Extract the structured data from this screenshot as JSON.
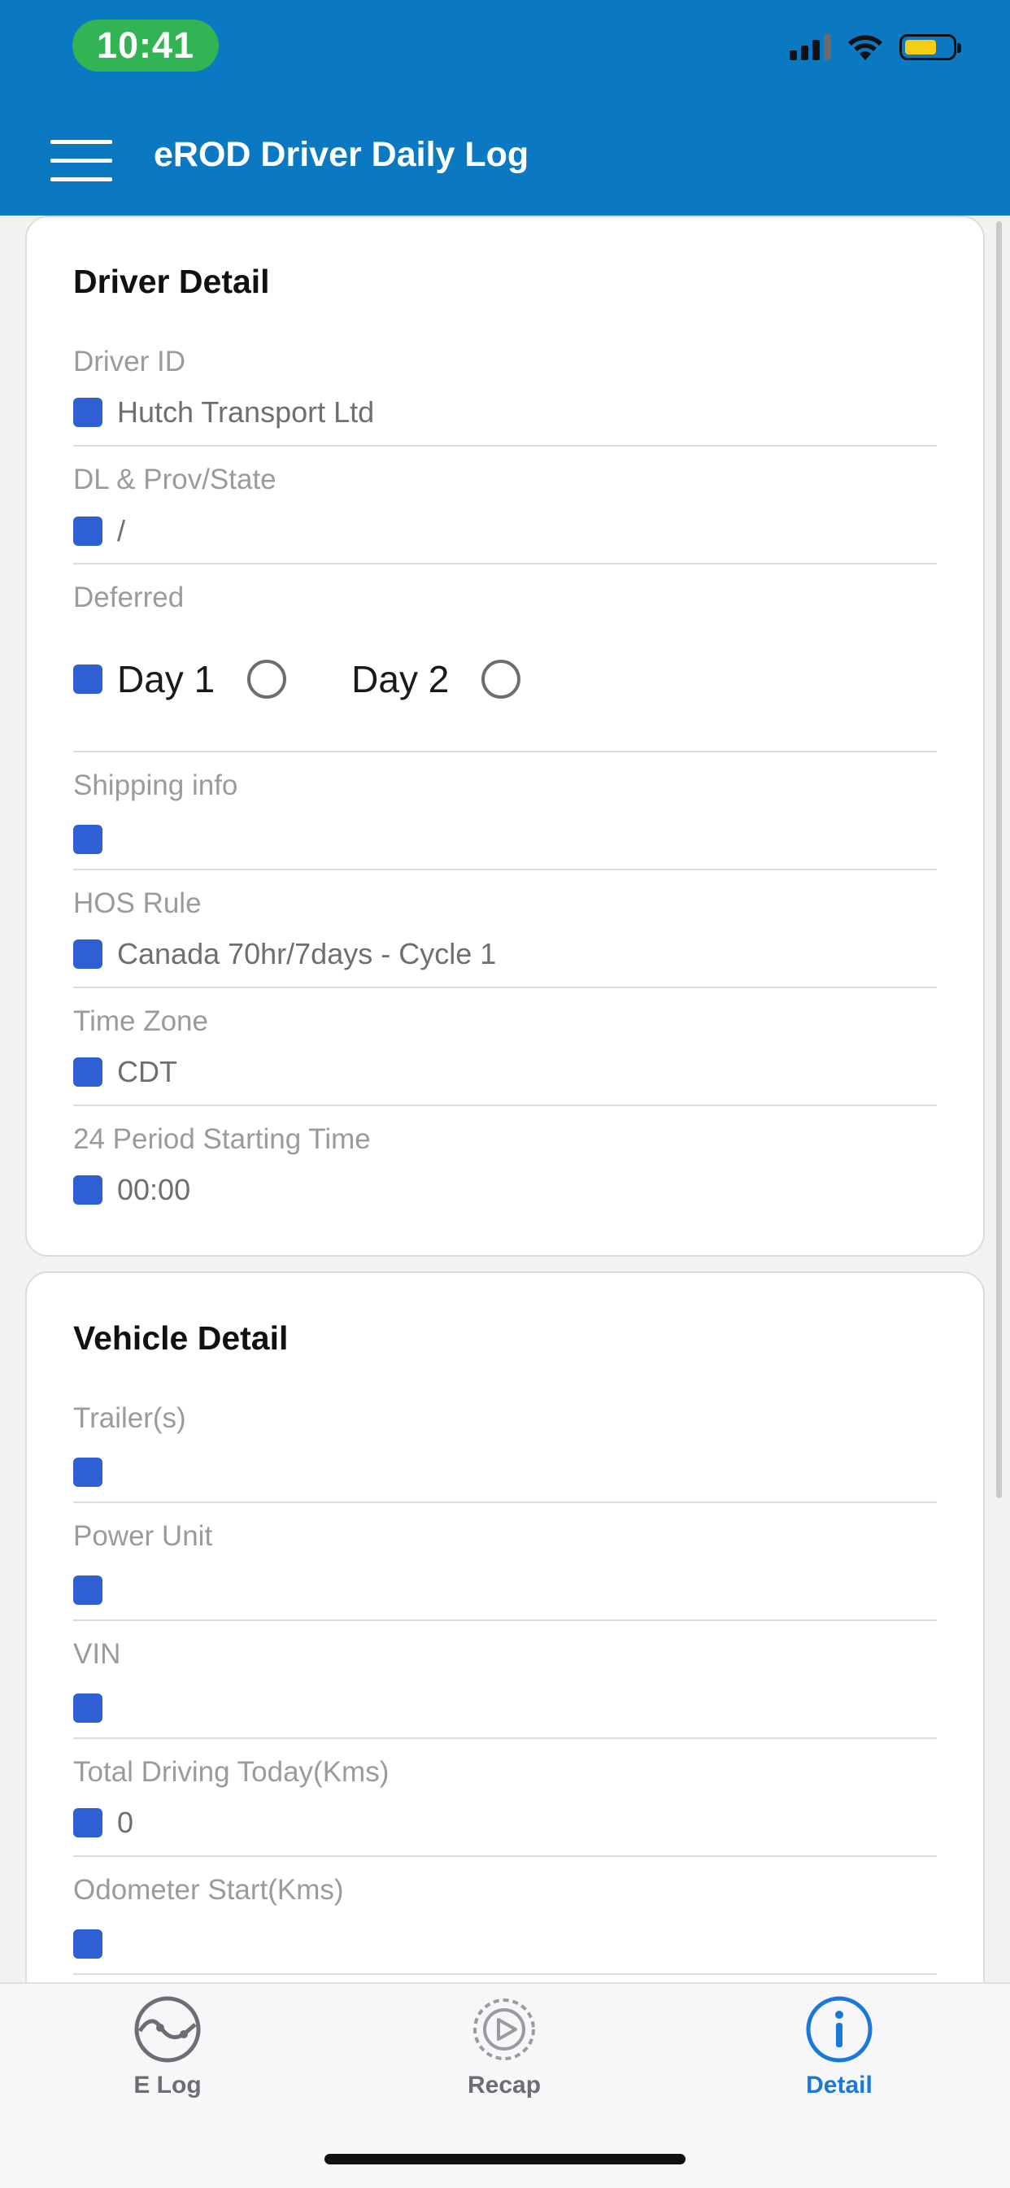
{
  "status_bar": {
    "time": "10:41"
  },
  "header": {
    "title": "eROD Driver Daily Log"
  },
  "driver_detail": {
    "title": "Driver Detail",
    "driver_id": {
      "label": "Driver ID",
      "value": "Hutch Transport Ltd"
    },
    "dl_prov_state": {
      "label": "DL & Prov/State",
      "value": "/"
    },
    "deferred": {
      "label": "Deferred",
      "day1": "Day 1",
      "day2": "Day 2"
    },
    "shipping_info": {
      "label": "Shipping info",
      "value": ""
    },
    "hos_rule": {
      "label": "HOS Rule",
      "value": "Canada 70hr/7days - Cycle 1"
    },
    "time_zone": {
      "label": "Time Zone",
      "value": "CDT"
    },
    "period_start": {
      "label": "24 Period Starting Time",
      "value": "00:00"
    }
  },
  "vehicle_detail": {
    "title": "Vehicle Detail",
    "trailers": {
      "label": "Trailer(s)",
      "value": ""
    },
    "power_unit": {
      "label": "Power Unit",
      "value": ""
    },
    "vin": {
      "label": "VIN",
      "value": ""
    },
    "total_driving": {
      "label": "Total Driving Today(Kms)",
      "value": "0"
    },
    "odometer_start": {
      "label": "Odometer Start(Kms)",
      "value": ""
    }
  },
  "tabs": [
    {
      "label": "E Log",
      "icon": "elog-icon"
    },
    {
      "label": "Recap",
      "icon": "recap-icon"
    },
    {
      "label": "Detail",
      "icon": "info-icon",
      "active": true
    }
  ],
  "colors": {
    "header": "#0a79c2",
    "checkbox": "#2f5fd4",
    "active_tab": "#1979d9",
    "time_pill": "#33b454"
  }
}
